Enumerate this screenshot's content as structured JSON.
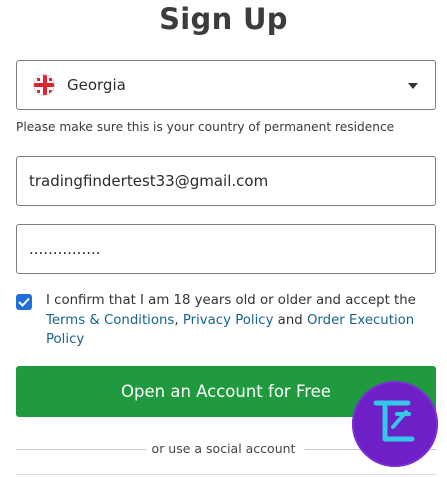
{
  "form": {
    "title": "Sign Up",
    "country": {
      "value": "Georgia",
      "flag_icon": "georgia-flag-icon"
    },
    "residence_hint": "Please make sure this is your country of permanent residence",
    "email_value": "tradingfindertest33@gmail.com",
    "password_value": "...............",
    "consent": {
      "checked": true,
      "text_start": "I confirm that I am 18 years old or older and accept the ",
      "terms_link": "Terms & Conditions",
      "separator": ", ",
      "privacy_link": "Privacy Policy",
      "and_text": " and ",
      "execution_link": "Order Execution Policy"
    },
    "submit_label": "Open an Account for Free",
    "social_divider_text": "or use a social account"
  },
  "colors": {
    "primary_button": "#1f9a3e",
    "checkbox": "#1e6fd9",
    "link": "#17638a",
    "badge": "#6e1fc6"
  },
  "watermark": {
    "icon": "tradingfinder-logo-icon"
  }
}
